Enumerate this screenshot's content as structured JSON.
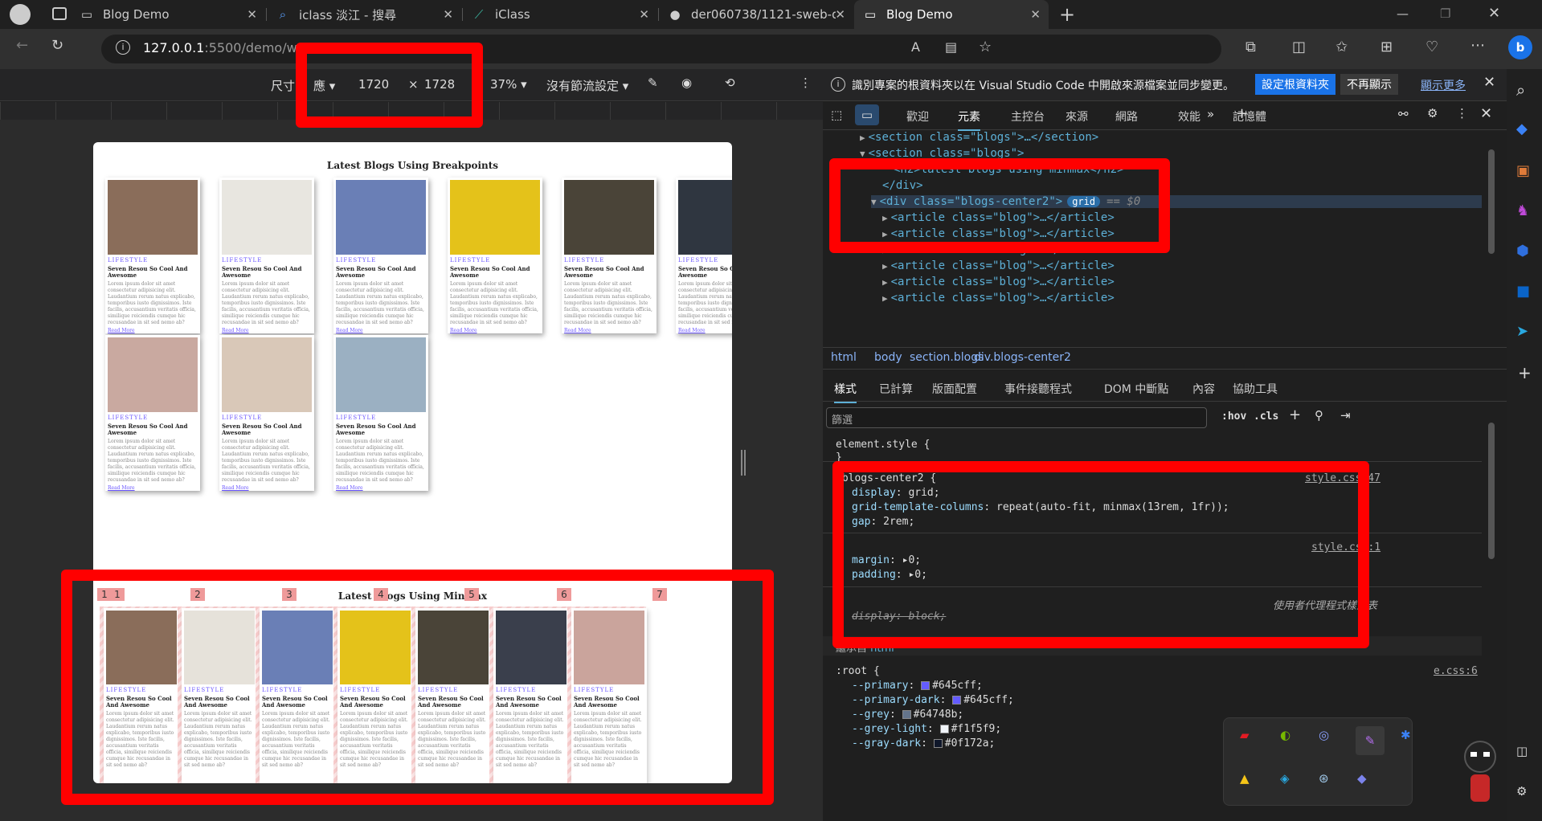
{
  "tabs": [
    {
      "title": "Blog Demo",
      "icon": "page-icon"
    },
    {
      "title": "iclass 淡江 - 搜尋",
      "icon": "search-icon"
    },
    {
      "title": "iClass",
      "icon": "iclass-icon"
    },
    {
      "title": "der060738/1121-sweb-demo-21",
      "icon": "github-icon"
    },
    {
      "title": "Blog Demo",
      "icon": "page-icon"
    }
  ],
  "address": {
    "host": "127.0.0.1",
    "rest": ":5500/demo/w0"
  },
  "device_toolbar": {
    "size_label": "尺寸:",
    "responsive": "應",
    "width": "1720",
    "times": "×",
    "height": "1728",
    "zoom": "37%",
    "throttle": "沒有節流設定"
  },
  "page": {
    "section1_title": "Latest Blogs Using Breakpoints",
    "section2_title": "Latest Blogs Using Minmax",
    "card_category": "LIFESTYLE",
    "card_title": "Seven Resou So Cool And Awesome",
    "card_body": "Lorem ipsum dolor sit amet consectetur adipisicing elit. Laudantium rerum natus explicabo, temporibus iusto dignissimos. Iste facilis, accusantium veritatis officia, similique reiciendis cumque hic recusandae in sit sed nemo ab?",
    "card_more": "Read More",
    "grid_numbers": [
      "1",
      "1",
      "2",
      "3",
      "4",
      "5",
      "6",
      "7"
    ],
    "images_row1": [
      "#8a6d5a",
      "#e8e6e0",
      "#6a7fb6",
      "#e4c21a",
      "#4a4438",
      "#2f3640"
    ],
    "images_row2": [
      "#c9a9a0",
      "#d9c8b8",
      "#9bb0c2"
    ],
    "images_row3": [
      "#8a6d5a",
      "#e6e2da",
      "#6a7fb6",
      "#e4c21a",
      "#4a4438",
      "#3a3f4c",
      "#caa49c"
    ]
  },
  "devtools": {
    "banner": "識別專案的根資料夾以在 Visual Studio Code 中開啟來源檔案並同步變更。",
    "banner_btn1": "設定根資料夾",
    "banner_btn2": "不再顯示",
    "banner_more": "顯示更多",
    "tabs": [
      "歡迎",
      "元素",
      "主控台",
      "來源",
      "網路",
      "效能",
      "記憶體"
    ],
    "dom_lines": [
      "<section class=\"blogs\">…</section>",
      "<section class=\"blogs\">",
      "<h2>latest blogs using minmax</h2>",
      "</div>",
      "<div class=\"blogs-center2\">",
      "<article class=\"blog\">…</article>",
      "<article class=\"blog\">…</article>",
      "<article class=\"blog\">…</article>",
      "<article class=\"blog\">…</article>",
      "<article class=\"blog\">…</article>",
      "<article class=\"blog\">…</article>"
    ],
    "grid_badge": "grid",
    "eq0": "== $0",
    "breadcrumbs": [
      "html",
      "body",
      "section.blogs",
      "div.blogs-center2"
    ],
    "style_tabs": [
      "樣式",
      "已計算",
      "版面配置",
      "事件接聽程式",
      "DOM 中斷點",
      "內容",
      "協助工具"
    ],
    "filter_placeholder": "篩選",
    "hov": ":hov",
    "cls": ".cls",
    "element_style": "element.style {",
    "rule1_selector": ".blogs-center2 {",
    "rule1_link": "style.css:47",
    "rule1_props": [
      [
        "display",
        "grid;"
      ],
      [
        "grid-template-columns",
        "repeat(auto-fit, minmax(13rem, 1fr));"
      ],
      [
        "gap",
        "2rem;"
      ]
    ],
    "rule2_link": "style.css:1",
    "rule2_props": [
      [
        "margin",
        "0;"
      ],
      [
        "padding",
        "0;"
      ]
    ],
    "ua_label": "使用者代理程式樣式表",
    "ua_prop": "display: block;",
    "inherit_label": "繼承自",
    "inherit_from": "html",
    "root_selector": ":root {",
    "root_link": "e.css:6",
    "root_vars": [
      [
        "--primary",
        "#645cff;",
        "#645cff"
      ],
      [
        "--primary-dark",
        "#645cff;",
        "#645cff"
      ],
      [
        "--grey",
        "#64748b;",
        "#64748b"
      ],
      [
        "--grey-light",
        "#f1f5f9;",
        "#f1f5f9"
      ],
      [
        "--gray-dark",
        "#0f172a;",
        "#0f172a"
      ]
    ]
  }
}
